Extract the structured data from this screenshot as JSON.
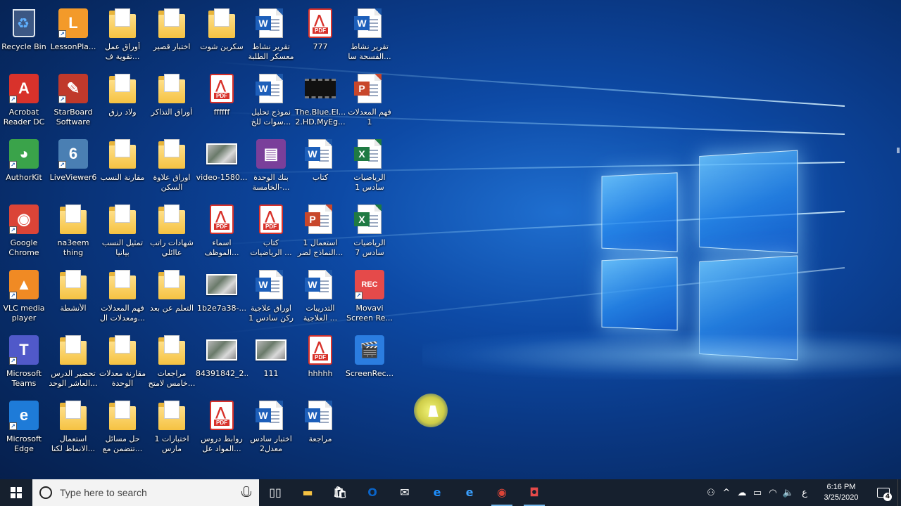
{
  "desktop": {
    "icons": [
      {
        "label": "Recycle Bin",
        "kind": "recycle",
        "icon": "recycle-bin-icon"
      },
      {
        "label": "LessonPla...",
        "kind": "generic",
        "color": "#f39a2a",
        "icon": "lessonplan-icon",
        "glyph": "L",
        "shortcut": true
      },
      {
        "label": "أوراق عمل\nتقوية ف...",
        "kind": "folder",
        "icon": "folder-icon"
      },
      {
        "label": "اختبار قصير",
        "kind": "folder",
        "icon": "folder-icon"
      },
      {
        "label": "سكرين شوت",
        "kind": "folder",
        "icon": "folder-icon"
      },
      {
        "label": "تقرير نشاط\nمعسكر الطلبة",
        "kind": "word",
        "icon": "word-document-icon"
      },
      {
        "label": "777",
        "kind": "pdf",
        "icon": "pdf-document-icon"
      },
      {
        "label": "تقرير نشاط\nالفسحة سا...",
        "kind": "word",
        "icon": "word-document-icon"
      },
      {
        "label": "Acrobat\nReader DC",
        "kind": "generic",
        "color": "#d8322b",
        "icon": "acrobat-reader-icon",
        "glyph": "A",
        "shortcut": true
      },
      {
        "label": "StarBoard\nSoftware",
        "kind": "generic",
        "color": "#c0392b",
        "icon": "starboard-icon",
        "glyph": "✎",
        "shortcut": true
      },
      {
        "label": "ولاد رزق",
        "kind": "folder",
        "icon": "folder-icon"
      },
      {
        "label": "أوراق التذاكر",
        "kind": "folder",
        "icon": "folder-icon"
      },
      {
        "label": "ffffff",
        "kind": "pdf",
        "icon": "pdf-document-icon"
      },
      {
        "label": "نموذج تحليل\nسوات للخ...",
        "kind": "word",
        "icon": "word-document-icon"
      },
      {
        "label": "The.Blue.El...\n2.HD.MyEg...",
        "kind": "film",
        "icon": "video-file-icon"
      },
      {
        "label": "فهم المعدلات\n1",
        "kind": "ppt",
        "icon": "powerpoint-document-icon"
      },
      {
        "label": "AuthorKit",
        "kind": "generic",
        "color": "#3aa34a",
        "icon": "authorkit-icon",
        "glyph": "◕",
        "shortcut": true
      },
      {
        "label": "LiveViewer6",
        "kind": "generic",
        "color": "#4a7fb3",
        "icon": "liveviewer-icon",
        "glyph": "6",
        "shortcut": true
      },
      {
        "label": "مقارنة النسب",
        "kind": "folder",
        "icon": "folder-icon"
      },
      {
        "label": "اوراق علاوة\nالسكن",
        "kind": "folder",
        "icon": "folder-icon"
      },
      {
        "label": "video-1580...",
        "kind": "photo",
        "icon": "video-thumbnail-icon"
      },
      {
        "label": "بنك الوحدة\nالخامسة-...",
        "kind": "generic",
        "color": "#7a3f9a",
        "icon": "winrar-archive-icon",
        "glyph": "▤"
      },
      {
        "label": "كتاب",
        "kind": "word",
        "icon": "word-document-icon"
      },
      {
        "label": "الرياضيات\nسادس 1",
        "kind": "excel",
        "icon": "excel-document-icon"
      },
      {
        "label": "Google\nChrome",
        "kind": "generic",
        "color": "#db4437",
        "icon": "chrome-icon",
        "glyph": "◉",
        "shortcut": true
      },
      {
        "label": "na3eem\nthing",
        "kind": "folder",
        "icon": "folder-icon"
      },
      {
        "label": "تمثيل النسب\nبيانيا",
        "kind": "folder",
        "icon": "folder-icon"
      },
      {
        "label": "شهادات راتب\nعاائلي",
        "kind": "folder",
        "icon": "folder-icon"
      },
      {
        "label": "اسماء\nالموظف...",
        "kind": "pdf",
        "icon": "pdf-document-icon"
      },
      {
        "label": "كتاب\nالرياضيات ...",
        "kind": "pdf",
        "icon": "pdf-document-icon"
      },
      {
        "label": "استعمال 1\nالنماذج لضر...",
        "kind": "ppt",
        "icon": "powerpoint-document-icon"
      },
      {
        "label": "الرياضيات\nسادس 7",
        "kind": "excel",
        "icon": "excel-document-icon"
      },
      {
        "label": "VLC media\nplayer",
        "kind": "generic",
        "color": "#f08a24",
        "icon": "vlc-icon",
        "glyph": "▲",
        "shortcut": true
      },
      {
        "label": "الأنشطة",
        "kind": "folder",
        "icon": "folder-icon"
      },
      {
        "label": "فهم المعدلات\nومعدلات ال...",
        "kind": "folder",
        "icon": "folder-icon"
      },
      {
        "label": "التعلم عن بعد",
        "kind": "folder",
        "icon": "folder-icon"
      },
      {
        "label": "1b2e7a38-...",
        "kind": "photo",
        "icon": "image-thumbnail-icon"
      },
      {
        "label": "اوراق علاجية\nركن سادس 1",
        "kind": "word",
        "icon": "word-document-icon"
      },
      {
        "label": "التدريبات\nالعلاجية ...",
        "kind": "word",
        "icon": "word-document-icon"
      },
      {
        "label": "Movavi\nScreen Re...",
        "kind": "generic",
        "color": "#e54a4a",
        "icon": "movavi-recorder-icon",
        "glyph": "REC",
        "shortcut": true
      },
      {
        "label": "Microsoft\nTeams",
        "kind": "generic",
        "color": "#5059c9",
        "icon": "teams-icon",
        "glyph": "T",
        "shortcut": true
      },
      {
        "label": "تحضير الدرس\nالعاشر الوحد...",
        "kind": "folder",
        "icon": "folder-icon"
      },
      {
        "label": "مقارنة معدلات\nالوحدة",
        "kind": "folder",
        "icon": "folder-icon"
      },
      {
        "label": "مراجعات\nخامس لامتح...",
        "kind": "folder",
        "icon": "folder-icon"
      },
      {
        "label": "84391842_2...",
        "kind": "photo",
        "icon": "image-thumbnail-icon"
      },
      {
        "label": "111",
        "kind": "photo",
        "icon": "image-thumbnail-icon"
      },
      {
        "label": "hhhhh",
        "kind": "pdf",
        "icon": "pdf-document-icon"
      },
      {
        "label": "ScreenRec...",
        "kind": "generic",
        "color": "#2b7de0",
        "icon": "screenrec-icon",
        "glyph": "🎬"
      },
      {
        "label": "Microsoft\nEdge",
        "kind": "generic",
        "color": "#1e7bd8",
        "icon": "edge-icon",
        "glyph": "e",
        "shortcut": true
      },
      {
        "label": "استعمال\nالانماط لكتا...",
        "kind": "folder",
        "icon": "folder-icon"
      },
      {
        "label": "حل مسائل\nتتضمن مع...",
        "kind": "folder",
        "icon": "folder-icon"
      },
      {
        "label": "اختبارات 1\nمارس",
        "kind": "folder",
        "icon": "folder-icon"
      },
      {
        "label": "روابط دروس\nالمواد عل...",
        "kind": "pdf",
        "icon": "pdf-document-icon"
      },
      {
        "label": "اختبار سادس\nمعدل2",
        "kind": "word",
        "icon": "word-document-icon"
      },
      {
        "label": "مراجعة",
        "kind": "word",
        "icon": "word-document-icon"
      }
    ]
  },
  "taskbar": {
    "search_placeholder": "Type here to search",
    "apps": [
      {
        "name": "task-view-button",
        "icon": "task-view-icon",
        "color": "#ffffff",
        "glyph": "▯▯"
      },
      {
        "name": "file-explorer-button",
        "icon": "file-explorer-icon",
        "color": "#f5c242",
        "glyph": "▬"
      },
      {
        "name": "store-button",
        "icon": "store-icon",
        "color": "#ffffff",
        "glyph": "🛍"
      },
      {
        "name": "outlook-button",
        "icon": "outlook-icon",
        "color": "#0a64c8",
        "glyph": "O"
      },
      {
        "name": "mail-button",
        "icon": "mail-icon",
        "color": "#ffffff",
        "glyph": "✉"
      },
      {
        "name": "edge-button",
        "icon": "edge-icon",
        "color": "#1e90ff",
        "glyph": "e"
      },
      {
        "name": "internet-explorer-button",
        "icon": "internet-explorer-icon",
        "color": "#3aa0ff",
        "glyph": "e"
      },
      {
        "name": "chrome-button",
        "icon": "chrome-icon",
        "color": "#db4437",
        "glyph": "◉",
        "active": true
      },
      {
        "name": "movavi-button",
        "icon": "movavi-recorder-icon",
        "color": "#e54a4a",
        "glyph": "◘",
        "active": true
      }
    ],
    "tray": {
      "people": "⚇",
      "chevron": "^",
      "ime": "ع",
      "time": "6:16 PM",
      "date": "3/25/2020",
      "notifications": "4"
    }
  }
}
